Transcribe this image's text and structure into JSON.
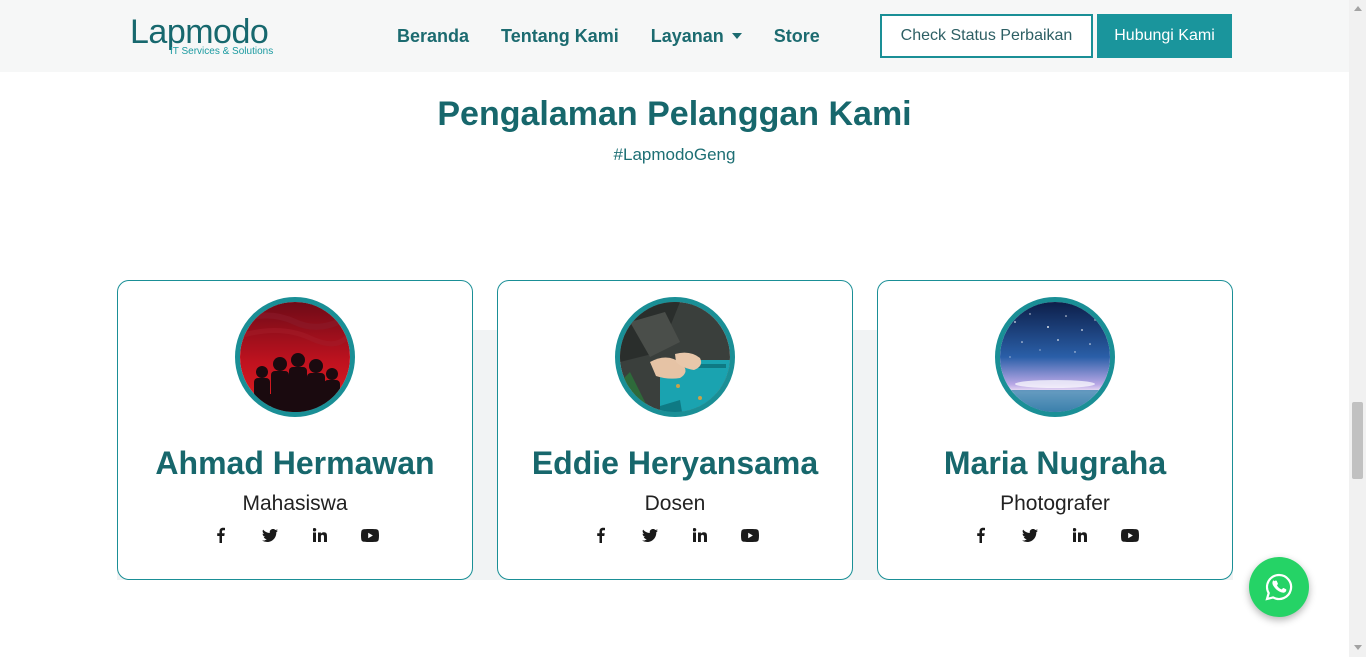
{
  "header": {
    "logo_text": "Lapmodo",
    "logo_tagline": "IT Services & Solutions",
    "nav": [
      {
        "label": "Beranda"
      },
      {
        "label": "Tentang Kami"
      },
      {
        "label": "Layanan"
      },
      {
        "label": "Store"
      }
    ],
    "check_status_label": "Check Status Perbaikan",
    "contact_label": "Hubungi Kami"
  },
  "section": {
    "title": "Pengalaman Pelanggan Kami",
    "subtitle": "#LapmodoGeng"
  },
  "testimonials": [
    {
      "name": "Ahmad Hermawan",
      "role": "Mahasiswa",
      "avatar": "red-silhouette-group-photo"
    },
    {
      "name": "Eddie Heryansama",
      "role": "Dosen",
      "avatar": "hands-on-turquoise-bag-photo"
    },
    {
      "name": "Maria Nugraha",
      "role": "Photografer",
      "avatar": "starry-night-sky-photo"
    }
  ],
  "social_icons": [
    "facebook-icon",
    "twitter-icon",
    "linkedin-icon",
    "youtube-icon"
  ],
  "floating": {
    "icon": "whatsapp-icon"
  },
  "colors": {
    "primary": "#17676c",
    "accent": "#1a959c",
    "whatsapp": "#25d366",
    "navbar_bg": "#f6f7f7"
  }
}
